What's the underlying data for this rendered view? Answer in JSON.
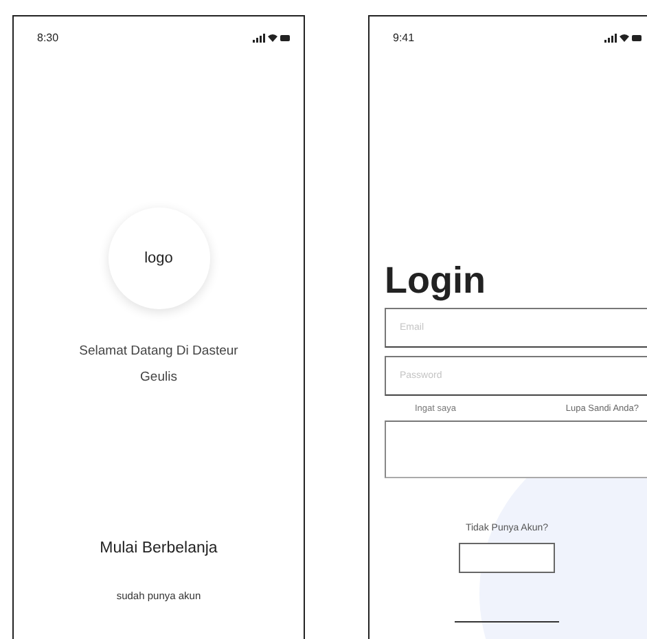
{
  "welcome_screen": {
    "status_time": "8:30",
    "logo": "logo",
    "welcome_text": "Selamat Datang Di Dasteur Geulis",
    "start_button": "Mulai Berbelanja",
    "login_link": "sudah punya akun"
  },
  "login_screen": {
    "status_time": "9:41",
    "title": "Login",
    "email": {
      "placeholder": "Email"
    },
    "password": {
      "placeholder": "Password"
    },
    "remember_label": "Ingat saya",
    "forgot_link": "Lupa Sandi Anda?",
    "signup_prompt": "Tidak Punya Akun?"
  }
}
